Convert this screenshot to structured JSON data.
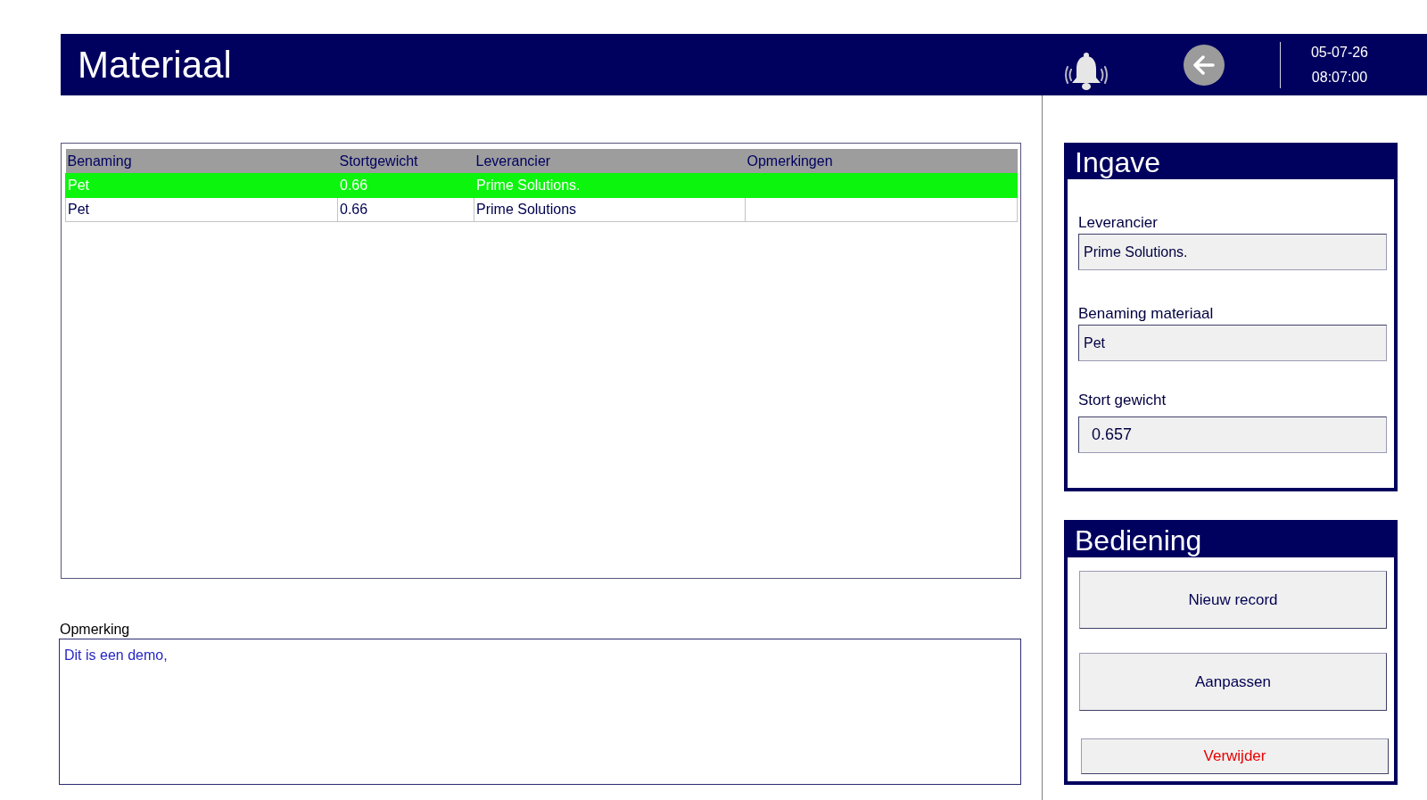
{
  "header": {
    "title": "Materiaal",
    "date": "05-07-26",
    "time": "08:07:00"
  },
  "table": {
    "columns": [
      "Benaming",
      "Stortgewicht",
      "Leverancier",
      "Opmerkingen"
    ],
    "rows": [
      {
        "cells": [
          "Pet",
          "0.66",
          "Prime Solutions."
        ],
        "selected": true
      },
      {
        "cells": [
          "Pet",
          "0.66",
          "Prime Solutions"
        ],
        "selected": false
      }
    ]
  },
  "remark": {
    "label": "Opmerking",
    "value": "Dit is een demo,"
  },
  "input_panel": {
    "title": "Ingave",
    "fields": [
      {
        "label": "Leverancier",
        "value": "Prime Solutions."
      },
      {
        "label": "Benaming materiaal",
        "value": "Pet"
      },
      {
        "label": "Stort gewicht",
        "value": "0.657"
      }
    ]
  },
  "control_panel": {
    "title": "Bediening",
    "buttons": [
      {
        "label": "Nieuw record",
        "kind": "normal"
      },
      {
        "label": "Aanpassen",
        "kind": "normal"
      },
      {
        "label": "Verwijder",
        "kind": "danger"
      }
    ]
  }
}
